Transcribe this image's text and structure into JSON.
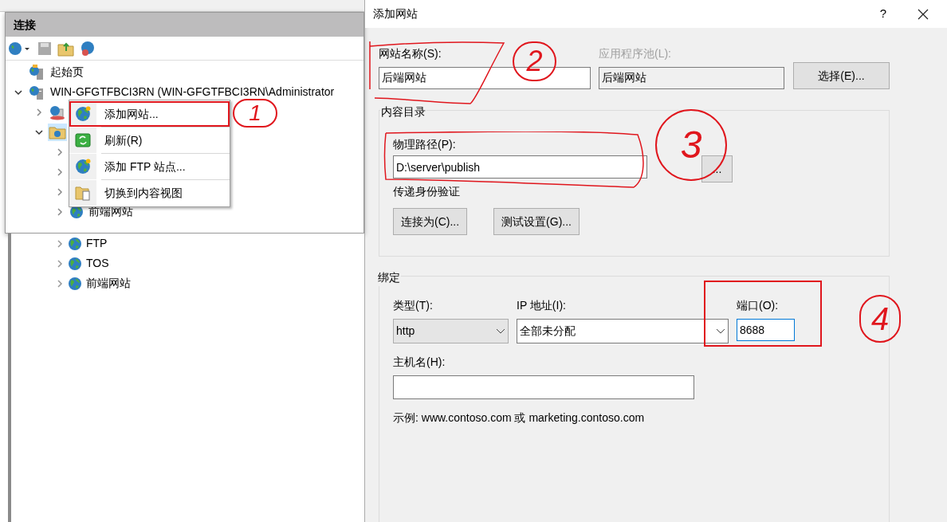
{
  "connections": {
    "title": "连接",
    "tree": [
      {
        "kind": "home",
        "label": "起始页"
      },
      {
        "kind": "server",
        "label": "WIN-GFGTFBCI3RN (WIN-GFGTFBCI3RN\\Administrator",
        "expanded": true,
        "children": [
          {
            "kind": "pool",
            "expanded": false
          },
          {
            "kind": "folder",
            "expanded": true,
            "selected": true,
            "children": [
              {
                "kind": "site",
                "expanded": false
              },
              {
                "kind": "site",
                "expanded": false
              },
              {
                "kind": "site",
                "expanded": false
              },
              {
                "kind": "site",
                "label": "前端网站",
                "expanded": false
              }
            ]
          }
        ]
      }
    ]
  },
  "context_menu": [
    {
      "kind": "add",
      "label": "添加网站...",
      "highlighted": true
    },
    {
      "kind": "refresh",
      "label": "刷新(R)",
      "highlighted": false
    },
    {
      "kind": "add",
      "label": "添加 FTP 站点...",
      "highlighted": false
    },
    {
      "kind": "content",
      "label": "切换到内容视图",
      "highlighted": false
    }
  ],
  "background_tree": [
    {
      "label": "FTP",
      "expanded": false
    },
    {
      "label": "TOS",
      "expanded": false
    },
    {
      "label": "前端网站",
      "expanded": false
    }
  ],
  "dialog": {
    "title": "添加网站",
    "help": "?",
    "site_name": {
      "label": "网站名称(S):",
      "value": "后端网站"
    },
    "app_pool": {
      "label": "应用程序池(L):",
      "value": "后端网站",
      "disabled": true
    },
    "select_button": "选择(E)...",
    "content_directory": {
      "title": "内容目录",
      "path_label": "物理路径(P):",
      "path_value": "D:\\server\\publish",
      "browse_button": "...",
      "auth_label": "传递身份验证",
      "buttons": [
        "连接为(C)...",
        "测试设置(G)..."
      ]
    },
    "binding": {
      "title": "绑定",
      "type_label": "类型(T):",
      "type_value": "http",
      "ip_label": "IP 地址(I):",
      "ip_value": "全部未分配",
      "port_label": "端口(O):",
      "port_value": "8688",
      "port_focused": true,
      "host_label": "主机名(H):",
      "example": "示例: www.contoso.com 或 marketing.contoso.com"
    }
  },
  "annotations": [
    {
      "number": "1"
    },
    {
      "number": "2"
    },
    {
      "number": "3"
    },
    {
      "number": "4"
    }
  ]
}
